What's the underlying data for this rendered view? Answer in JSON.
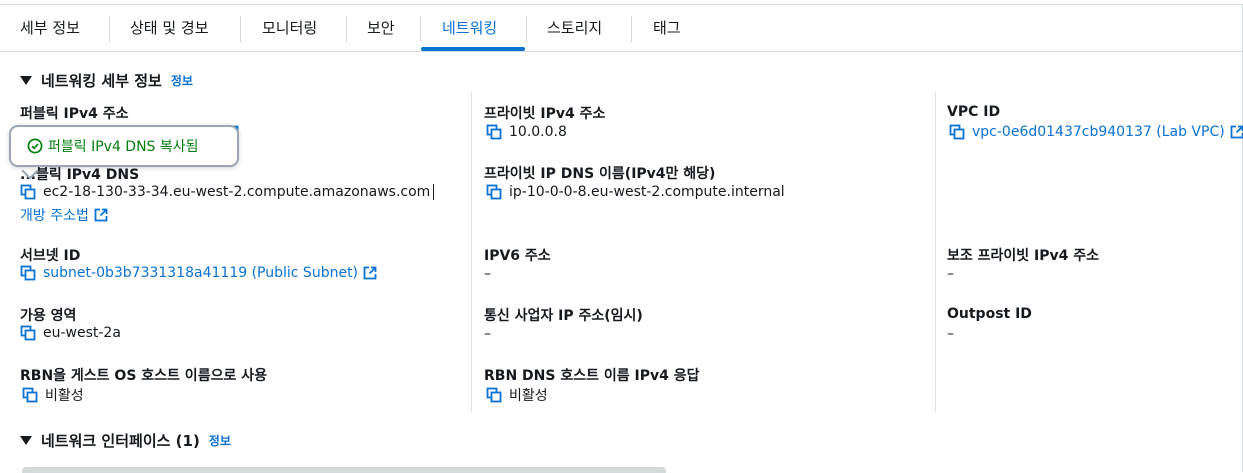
{
  "tabs": [
    {
      "label": "세부 정보"
    },
    {
      "label": "상태 및 경보"
    },
    {
      "label": "모니터링"
    },
    {
      "label": "보안"
    },
    {
      "label": "네트워킹",
      "active": true
    },
    {
      "label": "스토리지"
    },
    {
      "label": "태그"
    }
  ],
  "networking_details": {
    "title": "네트워킹 세부 정보",
    "info": "정보",
    "public_ipv4": {
      "label": "퍼블릭 IPv4 주소"
    },
    "tooltip": {
      "text": "퍼블릭 IPv4 DNS 복사됨"
    },
    "public_ipv4_dns": {
      "label": "퍼블릭 IPv4 DNS",
      "label_visible": "...블릭 IPv4 DNS",
      "value": "ec2-18-130-33-34.eu-west-2.compute.amazonaws.com",
      "open_address": "개방 주소법"
    },
    "subnet_id": {
      "label": "서브넷 ID",
      "value": "subnet-0b3b7331318a41119 (Public Subnet)"
    },
    "availability_zone": {
      "label": "가용 영역",
      "value": "eu-west-2a"
    },
    "rbn_guest_os": {
      "label": "RBN을 게스트 OS 호스트 이름으로 사용",
      "value": "비활성"
    },
    "private_ipv4": {
      "label": "프라이빗 IPv4 주소",
      "value": "10.0.0.8"
    },
    "private_ip_dns": {
      "label": "프라이빗 IP DNS 이름(IPv4만 해당)",
      "value": "ip-10-0-0-8.eu-west-2.compute.internal"
    },
    "ipv6": {
      "label": "IPV6 주소",
      "value": "–"
    },
    "carrier_ip": {
      "label": "통신 사업자 IP 주소(임시)",
      "value": "–"
    },
    "rbn_dns_response": {
      "label": "RBN DNS 호스트 이름 IPv4 응답",
      "value": "비활성"
    },
    "vpc_id": {
      "label": "VPC ID",
      "value": "vpc-0e6d01437cb940137 (Lab VPC)"
    },
    "secondary_private_ipv4": {
      "label": "보조 프라이빗 IPv4 주소",
      "value": "–"
    },
    "outpost_id": {
      "label": "Outpost ID",
      "value": "–"
    }
  },
  "network_interfaces": {
    "title": "네트워크 인터페이스 (1)",
    "info": "정보"
  },
  "colors": {
    "accent": "#0972d3",
    "success": "#037f0c",
    "text": "#16191f",
    "border": "#d5dbdb"
  },
  "icons": [
    "copy-icon",
    "external-link-icon",
    "check-circle-icon",
    "caret-down-icon"
  ]
}
